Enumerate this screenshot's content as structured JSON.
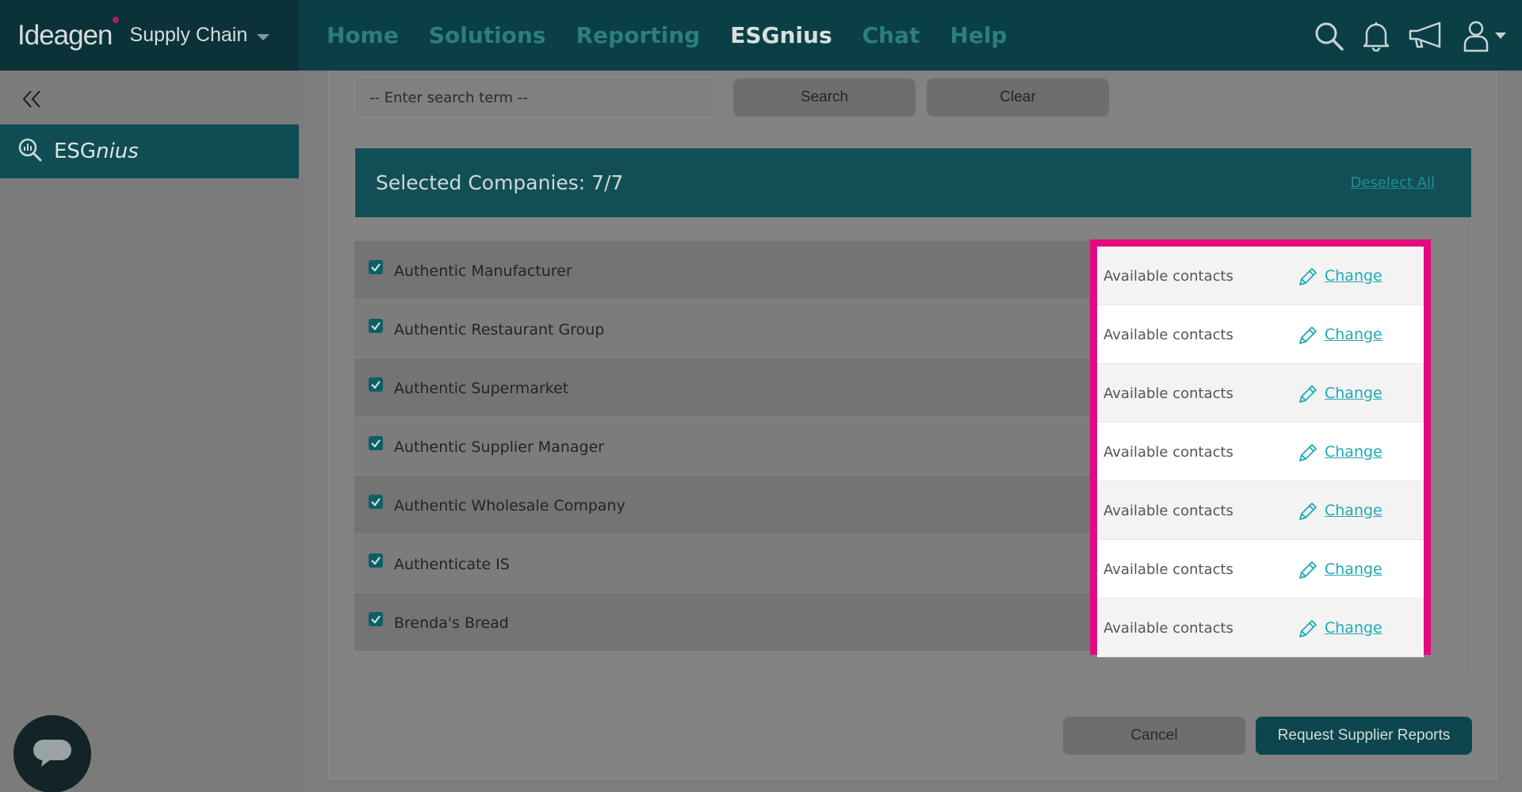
{
  "brand": {
    "logo": "Ideagen",
    "product": "Supply Chain"
  },
  "nav": {
    "items": [
      {
        "label": "Home",
        "active": false
      },
      {
        "label": "Solutions",
        "active": false
      },
      {
        "label": "Reporting",
        "active": false
      },
      {
        "label": "ESGnius",
        "active": true
      },
      {
        "label": "Chat",
        "active": false
      },
      {
        "label": "Help",
        "active": false
      }
    ],
    "icons": [
      "search-icon",
      "bell-icon",
      "megaphone-icon",
      "user-icon"
    ]
  },
  "sidebar": {
    "collapse_icon": "double-chevron-left-icon",
    "item": {
      "label_prefix": "ESG",
      "label_suffix": "nius",
      "icon": "search-chart-icon"
    }
  },
  "search": {
    "placeholder": "-- Enter search term --",
    "search_label": "Search",
    "clear_label": "Clear"
  },
  "panel": {
    "title": "Selected Companies: 7/7",
    "deselect_label": "Deselect All",
    "companies": [
      {
        "name": "Authentic Manufacturer",
        "checked": true,
        "contacts": "Available contacts",
        "action": "Change"
      },
      {
        "name": "Authentic Restaurant Group",
        "checked": true,
        "contacts": "Available contacts",
        "action": "Change"
      },
      {
        "name": "Authentic Supermarket",
        "checked": true,
        "contacts": "Available contacts",
        "action": "Change"
      },
      {
        "name": "Authentic Supplier Manager",
        "checked": true,
        "contacts": "Available contacts",
        "action": "Change"
      },
      {
        "name": "Authentic Wholesale Company",
        "checked": true,
        "contacts": "Available contacts",
        "action": "Change"
      },
      {
        "name": "Authenticate IS",
        "checked": true,
        "contacts": "Available contacts",
        "action": "Change"
      },
      {
        "name": "Brenda's Bread",
        "checked": true,
        "contacts": "Available contacts",
        "action": "Change"
      }
    ]
  },
  "footer": {
    "cancel_label": "Cancel",
    "request_label": "Request Supplier Reports"
  },
  "colors": {
    "highlight": "#e5097f",
    "accent": "#21a9b4",
    "nav_bg": "#0a3f45"
  }
}
